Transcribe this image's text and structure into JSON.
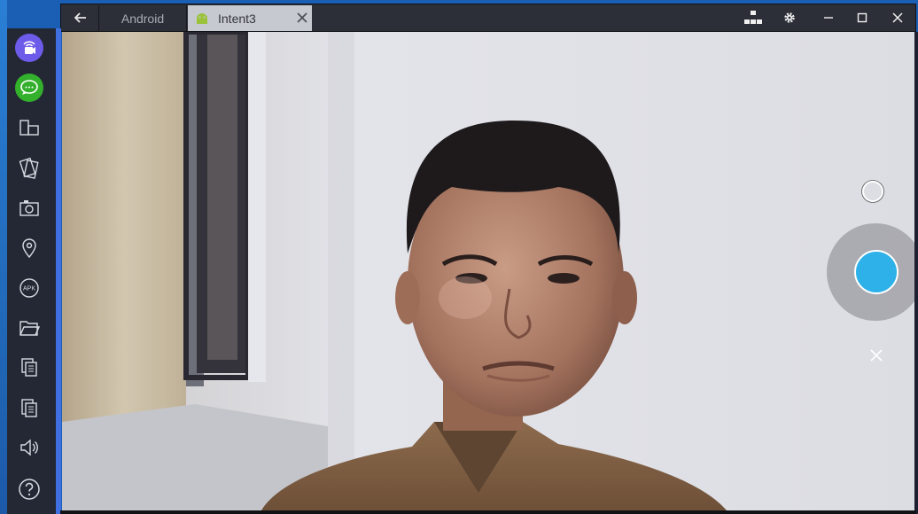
{
  "window": {
    "tabs": [
      {
        "label": "Android",
        "active": false
      },
      {
        "label": "Intent3",
        "active": true
      }
    ]
  },
  "sidebar": {
    "items": [
      {
        "icon": "broadcast-icon"
      },
      {
        "icon": "chat-icon"
      },
      {
        "icon": "rotate-screen-icon"
      },
      {
        "icon": "shake-icon"
      },
      {
        "icon": "screenshot-camera-icon"
      },
      {
        "icon": "location-icon"
      },
      {
        "icon": "apk-icon"
      },
      {
        "icon": "folder-icon"
      },
      {
        "icon": "copy-icon"
      },
      {
        "icon": "paste-icon"
      },
      {
        "icon": "volume-icon"
      },
      {
        "icon": "help-icon"
      }
    ],
    "apk_label": "APK"
  },
  "colors": {
    "accent_blue": "#2db1e8",
    "sidebar_bg": "#232834",
    "sidebar_border": "#3f6fe0",
    "titlebar_bg": "#2c2f38",
    "active_tab": "#c6c9cf"
  }
}
